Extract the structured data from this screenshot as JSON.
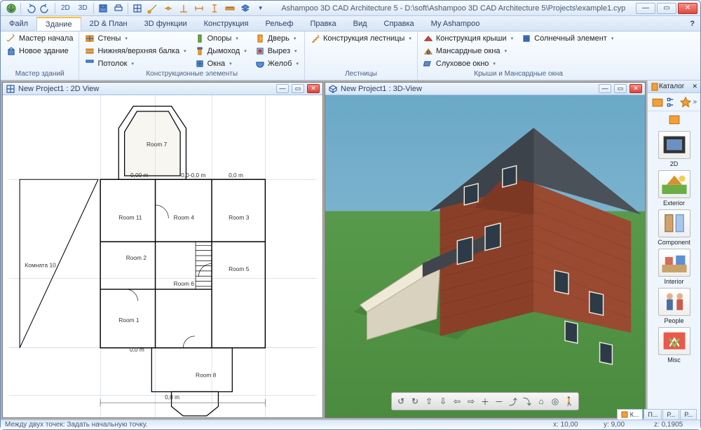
{
  "title": "Ashampoo 3D CAD Architecture 5 - D:\\soft\\Ashampoo 3D CAD Architecture 5\\Projects\\example1.cyp",
  "qat": {
    "labels": {
      "d2": "2D",
      "d3": "3D"
    }
  },
  "menubar": [
    {
      "key": "file",
      "label": "Файл"
    },
    {
      "key": "building",
      "label": "Здание",
      "active": true
    },
    {
      "key": "plan",
      "label": "2D & План"
    },
    {
      "key": "fn3d",
      "label": "3D функции"
    },
    {
      "key": "construction",
      "label": "Конструкция"
    },
    {
      "key": "relief",
      "label": "Рельеф"
    },
    {
      "key": "edit",
      "label": "Правка"
    },
    {
      "key": "view",
      "label": "Вид"
    },
    {
      "key": "help",
      "label": "Справка"
    },
    {
      "key": "my",
      "label": "My Ashampoo"
    }
  ],
  "ribbon": {
    "groups": [
      {
        "key": "wizard",
        "label": "Мастер зданий",
        "items": [
          {
            "key": "wizard_start",
            "label": "Мастер начала"
          },
          {
            "key": "new_building",
            "label": "Новое здание"
          }
        ]
      },
      {
        "key": "construction_elements",
        "label": "Конструкционные элементы",
        "cols": [
          [
            {
              "key": "walls",
              "label": "Стены",
              "dd": true
            },
            {
              "key": "top_bottom_beam",
              "label": "Нижняя/верхняя балка",
              "dd": true
            },
            {
              "key": "ceiling",
              "label": "Потолок",
              "dd": true
            }
          ],
          [
            {
              "key": "supports",
              "label": "Опоры",
              "dd": true
            },
            {
              "key": "chimney",
              "label": "Дымоход",
              "dd": true
            },
            {
              "key": "windows",
              "label": "Окна",
              "dd": true
            }
          ],
          [
            {
              "key": "door",
              "label": "Дверь",
              "dd": true
            },
            {
              "key": "cutout",
              "label": "Вырез",
              "dd": true
            },
            {
              "key": "gutter",
              "label": "Желоб",
              "dd": true
            }
          ]
        ]
      },
      {
        "key": "stairs",
        "label": "Лестницы",
        "items": [
          {
            "key": "stair_construction",
            "label": "Конструкция лестницы",
            "dd": true
          }
        ]
      },
      {
        "key": "roofs",
        "label": "Крыши и Мансардные окна",
        "cols": [
          [
            {
              "key": "roof_construction",
              "label": "Конструкция крыши",
              "dd": true
            },
            {
              "key": "dormers",
              "label": "Мансардные окна",
              "dd": true
            },
            {
              "key": "skylight",
              "label": "Слуховое окно",
              "dd": true
            }
          ],
          [
            {
              "key": "solar",
              "label": "Солнечный элемент",
              "dd": true
            }
          ]
        ]
      }
    ]
  },
  "docs": {
    "left": {
      "title": "New Project1 : 2D View",
      "dims": [
        "0,00 m",
        "0,0-0,0 m",
        "0,0 m",
        "0,0 m",
        "0,0 m"
      ],
      "rooms": [
        "Room 7",
        "Room 11",
        "Room 3",
        "Room 5",
        "Room 2",
        "Room 1",
        "Room 6",
        "Room 8",
        "Room 4",
        "Комната 10",
        "0.0 m",
        "0.0 m"
      ]
    },
    "right": {
      "title": "New Project1 : 3D-View"
    }
  },
  "catalog": {
    "title": "Каталог",
    "items": [
      {
        "key": "2d",
        "label": "2D"
      },
      {
        "key": "exterior",
        "label": "Exterior"
      },
      {
        "key": "component",
        "label": "Component"
      },
      {
        "key": "interior",
        "label": "Interior"
      },
      {
        "key": "people",
        "label": "People"
      },
      {
        "key": "misc",
        "label": "Misc"
      }
    ]
  },
  "paneltabs": [
    {
      "key": "k",
      "label": "К..."
    },
    {
      "key": "p1",
      "label": "П..."
    },
    {
      "key": "r",
      "label": "Р..."
    },
    {
      "key": "p2",
      "label": "Р..."
    }
  ],
  "status": {
    "hint": "Между двух точек: Задать начальную точку.",
    "x_label": "x:",
    "x": "10,00",
    "y_label": "y:",
    "y": "9,00",
    "z_label": "z:",
    "z": "0,1905"
  }
}
